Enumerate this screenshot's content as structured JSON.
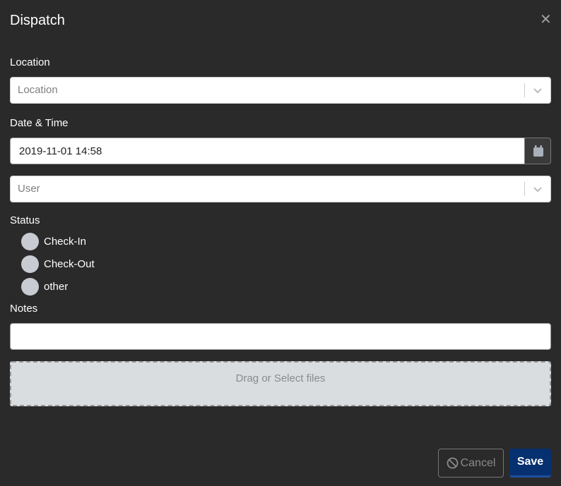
{
  "dialog": {
    "title": "Dispatch",
    "close_icon": "close-icon"
  },
  "form": {
    "location": {
      "label": "Location",
      "placeholder": "Location",
      "icon": "chevron-down-icon"
    },
    "datetime": {
      "label": "Date & Time",
      "value": "2019-11-01 14:58",
      "icon": "calendar-icon"
    },
    "user": {
      "placeholder": "User",
      "icon": "chevron-down-icon"
    },
    "status": {
      "label": "Status",
      "options": [
        {
          "label": "Check-In",
          "selected": false
        },
        {
          "label": "Check-Out",
          "selected": false
        },
        {
          "label": "other",
          "selected": false
        }
      ]
    },
    "notes": {
      "label": "Notes",
      "value": ""
    },
    "dropzone": {
      "text": "Drag or Select files"
    }
  },
  "footer": {
    "cancel_label": "Cancel",
    "cancel_icon": "ban-icon",
    "save_label": "Save"
  },
  "colors": {
    "background": "#2a2a2a",
    "primary": "#06306f",
    "radio": "#c8ccd2",
    "dropzone": "#dadde0"
  }
}
